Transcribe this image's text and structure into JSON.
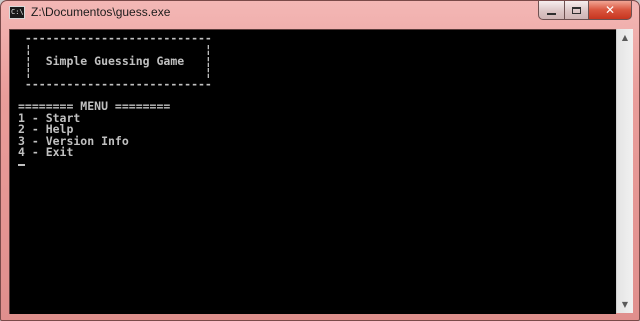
{
  "window": {
    "title": "Z:\\Documentos\\guess.exe"
  },
  "titlebar": {
    "icon_text": "C:\\."
  },
  "controls": {
    "close_symbol": "✕"
  },
  "console": {
    "lines": [
      " ---------------------------",
      " ¦                         ¦",
      " ¦  Simple Guessing Game   ¦",
      " ¦                         ¦",
      " ---------------------------",
      "",
      "======== MENU ========",
      "1 - Start",
      "2 - Help",
      "3 - Version Info",
      "4 - Exit"
    ]
  },
  "scrollbar": {
    "up_arrow": "▲",
    "down_arrow": "▼"
  }
}
